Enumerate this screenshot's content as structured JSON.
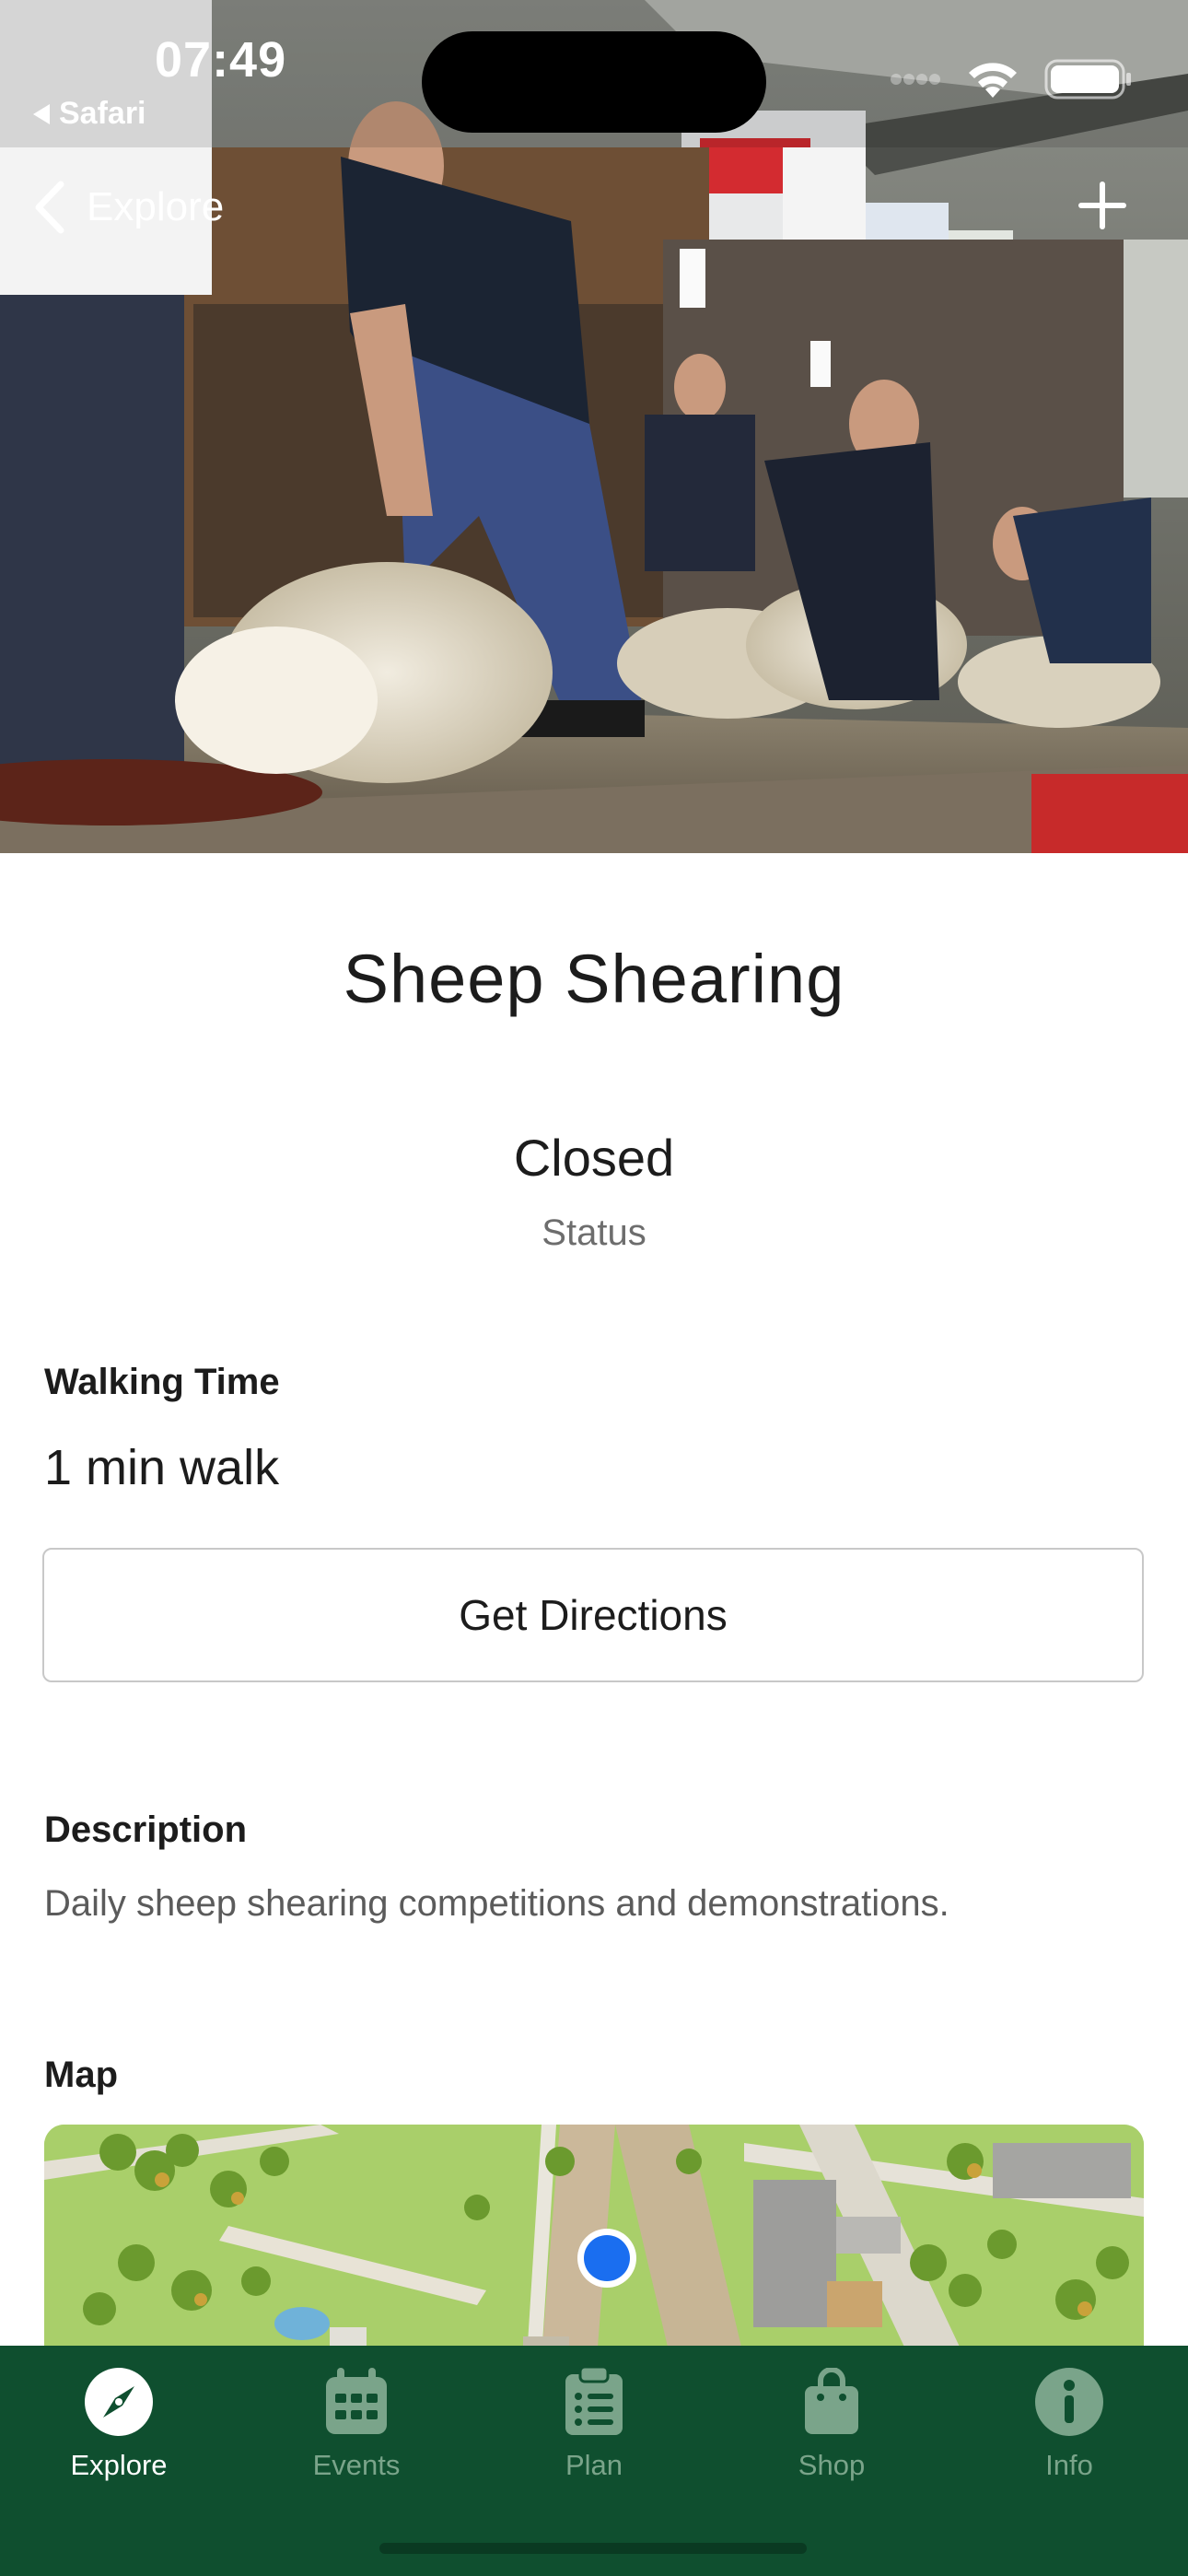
{
  "status_bar": {
    "time": "07:49",
    "back_app": "Safari"
  },
  "nav": {
    "back_label": "Explore"
  },
  "attraction": {
    "title": "Sheep Shearing",
    "status_value": "Closed",
    "status_label": "Status"
  },
  "walking": {
    "label": "Walking Time",
    "value": "1 min walk"
  },
  "directions_button": "Get Directions",
  "description": {
    "label": "Description",
    "text": "Daily sheep shearing competitions and demonstrations."
  },
  "map": {
    "label": "Map"
  },
  "tabs": [
    {
      "label": "Explore",
      "icon": "compass-icon",
      "active": true
    },
    {
      "label": "Events",
      "icon": "calendar-icon",
      "active": false
    },
    {
      "label": "Plan",
      "icon": "clipboard-icon",
      "active": false
    },
    {
      "label": "Shop",
      "icon": "shopping-bag-icon",
      "active": false
    },
    {
      "label": "Info",
      "icon": "info-icon",
      "active": false
    }
  ],
  "colors": {
    "tabbar": "#0f4f2f",
    "location_dot": "#1a6ef0"
  }
}
